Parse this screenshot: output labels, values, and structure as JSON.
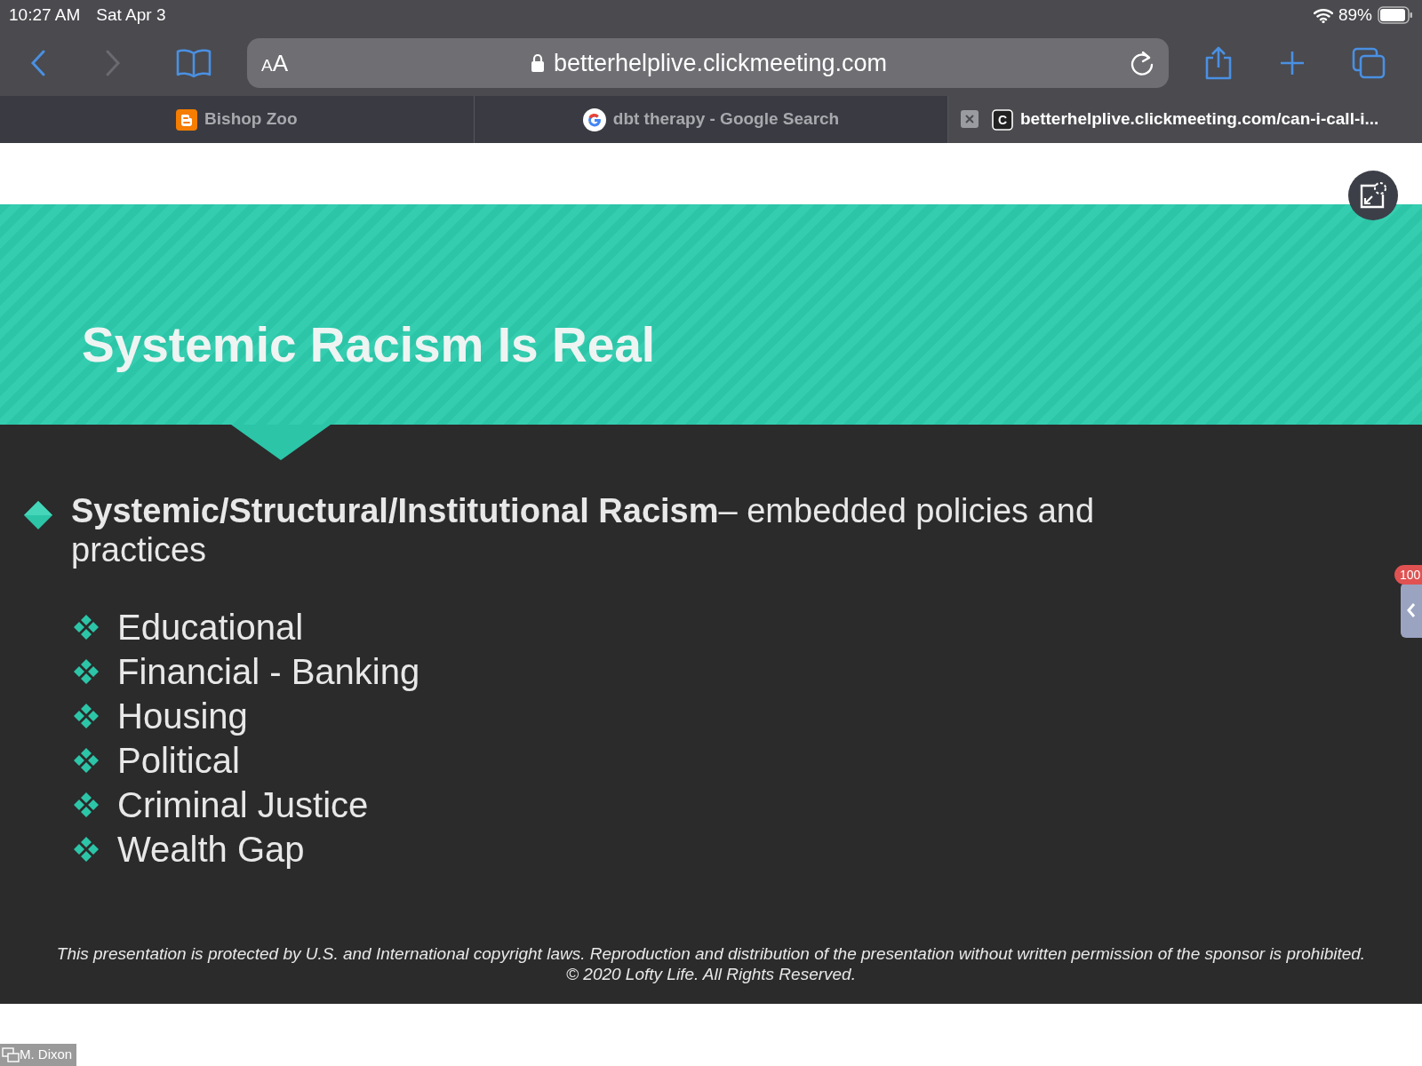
{
  "status_bar": {
    "time": "10:27 AM",
    "date": "Sat Apr 3",
    "battery": "89%"
  },
  "toolbar": {
    "text_size": "AA",
    "url": "betterhelplive.clickmeeting.com"
  },
  "tabs": [
    {
      "title": "Bishop Zoo",
      "kind": "blog",
      "selected": false
    },
    {
      "title": "dbt therapy - Google Search",
      "kind": "google",
      "selected": false
    },
    {
      "title": "betterhelplive.clickmeeting.com/can-i-call-i...",
      "kind": "site",
      "favicon": "C",
      "selected": true
    }
  ],
  "slide": {
    "title": "Systemic Racism Is Real",
    "bullet": "**Systemic/Structural/Institutional Racism**– embedded policies and practices",
    "items": [
      "Educational",
      "Financial - Banking",
      "Housing",
      "Political",
      "Criminal Justice",
      "Wealth Gap"
    ],
    "footer": [
      "This presentation is protected by U.S. and International copyright laws. Reproduction and distribution of the presentation without written permission of the sponsor is prohibited.",
      "© 2020 Lofty Life. All Rights Reserved."
    ]
  },
  "side_badge": "100",
  "presenter": "M. Dixon"
}
